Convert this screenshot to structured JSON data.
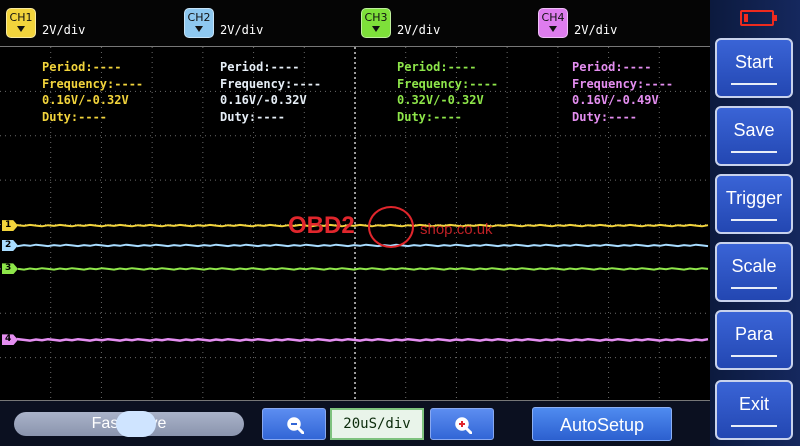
{
  "colors": {
    "ch1": "#f2d43c",
    "ch2": "#a8dcff",
    "ch3": "#8ee64a",
    "ch4": "#e48ef0",
    "grid": "#6a6a6a",
    "accent_button": "#3266d6",
    "battery": "#ee2a1e"
  },
  "channels": [
    {
      "name": "CH1",
      "scale": "2V/div",
      "period": "Period:----",
      "frequency": "Frequency:----",
      "voltage": "0.16V/-0.32V",
      "duty": "Duty:----",
      "marker": "1",
      "level": 0.503
    },
    {
      "name": "CH2",
      "scale": "2V/div",
      "period": "Period:----",
      "frequency": "Frequency:----",
      "voltage": "0.16V/-0.32V",
      "duty": "Duty:----",
      "marker": "2",
      "level": 0.559
    },
    {
      "name": "CH3",
      "scale": "2V/div",
      "period": "Period:----",
      "frequency": "Frequency:----",
      "voltage": "0.32V/-0.32V",
      "duty": "Duty:----",
      "marker": "3",
      "level": 0.625
    },
    {
      "name": "CH4",
      "scale": "2V/div",
      "period": "Period:----",
      "frequency": "Frequency:----",
      "voltage": "0.16V/-0.49V",
      "duty": "Duty:----",
      "marker": "4",
      "level": 0.825
    }
  ],
  "watermark": {
    "brand": "OBD2",
    "domain": "shop.co.uk"
  },
  "bottom": {
    "fast_move": "Fast Move",
    "timebase": "20uS/div",
    "autosetup": "AutoSetup",
    "zoom_out_icon": "magnifier-minus-icon",
    "zoom_in_icon": "magnifier-plus-icon"
  },
  "sidebar": {
    "battery_icon": "battery-low-icon",
    "battery_level": 0.15,
    "buttons": [
      "Start",
      "Save",
      "Trigger",
      "Scale",
      "Para",
      "Exit"
    ]
  }
}
